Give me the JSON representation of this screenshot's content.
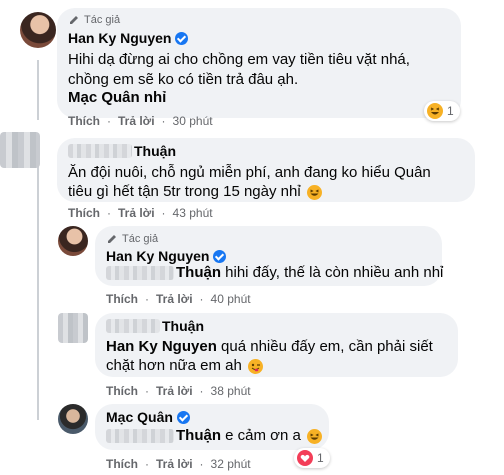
{
  "comments": [
    {
      "author_badge": "Tác giả",
      "author_name": "Han Ky Nguyen",
      "lines": [
        "Hihi dạ đừng ai cho chồng em vay tiền tiêu vặt nhá,",
        "chồng em sẽ ko có tiền trả đâu ạh.",
        "Mạc Quân nhỉ"
      ],
      "reaction_count": "1",
      "reaction_type": "haha-icon",
      "like": "Thích",
      "reply": "Trả lời",
      "time": "30 phút"
    },
    {
      "author_name": "Thuận",
      "lines": [
        "Ăn đội nuôi, chỗ ngủ miễn phí, anh đang ko hiểu Quân",
        "tiêu gì hết tận 5tr trong 15 ngày nhỉ"
      ],
      "like": "Thích",
      "reply": "Trả lời",
      "time": "43 phút"
    },
    {
      "author_badge": "Tác giả",
      "author_name": "Han Ky Nguyen",
      "mention": "Thuận",
      "lines": [
        " hihi đấy, thế là còn nhiều anh nhỉ"
      ],
      "like": "Thích",
      "reply": "Trả lời",
      "time": "40 phút"
    },
    {
      "author_name": "Thuận",
      "mention": "Han Ky Nguyen",
      "lines": [
        " quá nhiều đấy em, cần phải siết",
        "chặt hơn nữa em ah"
      ],
      "like": "Thích",
      "reply": "Trả lời",
      "time": "38 phút"
    },
    {
      "author_name": "Mạc Quân",
      "mention": "Thuận",
      "lines": [
        " e cảm ơn a"
      ],
      "reaction_count": "1",
      "reaction_type": "love-icon",
      "like": "Thích",
      "reply": "Trả lời",
      "time": "32 phút"
    }
  ],
  "colors": {
    "bubble": "#f0f2f5",
    "verified": "#1877f2",
    "meta_text": "#65676b",
    "love": "#f33e58",
    "haha": "#f7b125"
  }
}
